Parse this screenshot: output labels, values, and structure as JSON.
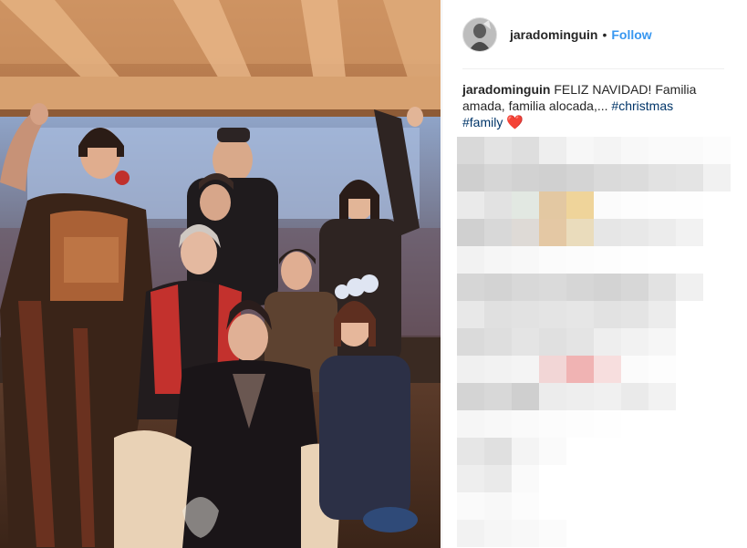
{
  "post": {
    "username": "jaradominguin",
    "separator": "•",
    "follow_label": "Follow"
  },
  "caption": {
    "username": "jaradominguin",
    "text": "FELIZ NAVIDAD! Familia amada, familia alocada,...",
    "hashtag_1": "#christmas",
    "hashtag_2": "#family",
    "emoji": "❤️"
  },
  "colors": {
    "follow": "#3897f0",
    "hashtag": "#003569",
    "heart": "#e0312a"
  },
  "icons": {
    "avatar": "profile-photo",
    "heart": "red-heart-emoji"
  },
  "comments_region": "pixelated-blurred"
}
